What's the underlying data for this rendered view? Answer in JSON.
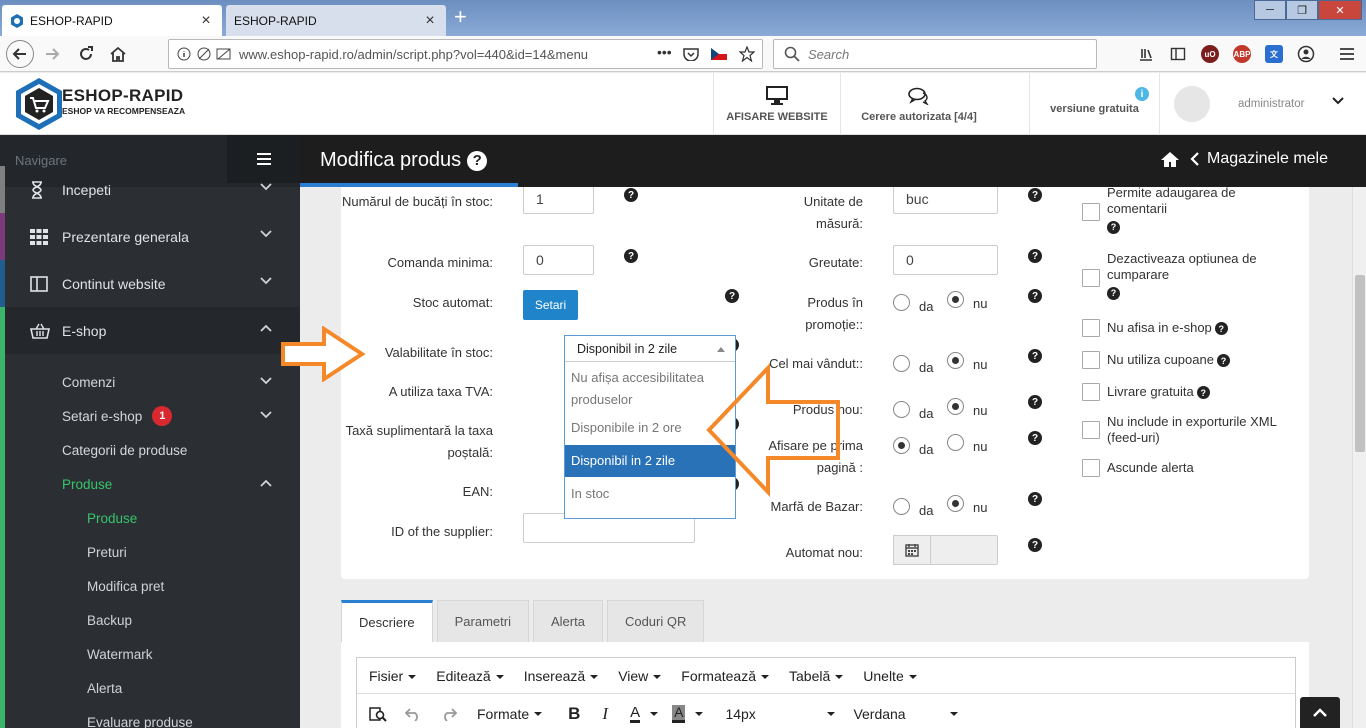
{
  "browser": {
    "tabs": [
      {
        "title": "ESHOP-RAPID"
      },
      {
        "title": "ESHOP-RAPID"
      }
    ],
    "url": "www.eshop-rapid.ro/admin/script.php?vol=440&id=14&menu",
    "search_placeholder": "Search"
  },
  "header": {
    "logo_name": "ESHOP-RAPID",
    "logo_tagline": "ESHOP VA RECOMPENSEAZA",
    "website_button": "AFISARE WEBSITE",
    "request_button": "Cerere autorizata [4/4]",
    "version_label": "versiune gratuita",
    "user_name": "administrator"
  },
  "sidebar": {
    "nav_label": "Navigare",
    "items": [
      {
        "label": "Incepeti",
        "icon": "hourglass-icon"
      },
      {
        "label": "Prezentare generala",
        "icon": "grid-icon"
      },
      {
        "label": "Continut website",
        "icon": "columns-icon"
      },
      {
        "label": "E-shop",
        "icon": "basket-icon"
      }
    ],
    "eshop_sub": [
      {
        "label": "Comenzi"
      },
      {
        "label": "Setari e-shop",
        "badge": "1"
      },
      {
        "label": "Categorii de produse"
      },
      {
        "label": "Produse"
      }
    ],
    "produse_sub": [
      {
        "label": "Produse"
      },
      {
        "label": "Preturi"
      },
      {
        "label": "Modifica pret"
      },
      {
        "label": "Backup"
      },
      {
        "label": "Watermark"
      },
      {
        "label": "Alerta"
      },
      {
        "label": "Evaluare produse"
      }
    ]
  },
  "titlebar": {
    "title": "Modifica produs",
    "stores_link": "Magazinele mele"
  },
  "form": {
    "left": {
      "pieces_label": "Numărul de bucăți în stoc:",
      "pieces_value": "1",
      "min_order_label": "Comanda minima:",
      "min_order_value": "0",
      "auto_stock_label": "Stoc automat:",
      "settings_button": "Setari",
      "availability_label": "Valabilitate în stoc:",
      "vat_label": "A utiliza taxa TVA:",
      "postal_label": "Taxă suplimentară la taxa poștală:",
      "ean_label": "EAN:",
      "supplier_label": "ID of the supplier:"
    },
    "dropdown": {
      "selected": "Disponibil in 2 zile",
      "options": [
        "Nu afișa accesibilitatea produselor",
        "Disponibile in 2 ore",
        "Disponibil in 2 zile",
        "In stoc"
      ]
    },
    "middle": {
      "unit_label": "Unitate de măsură:",
      "unit_value": "buc",
      "weight_label": "Greutate:",
      "weight_value": "0",
      "promo_label": "Produs în promoție::",
      "bestseller_label": "Cel mai vândut::",
      "new_label": "Produs nou:",
      "homepage_label": "Afisare pe prima pagină :",
      "bazaar_label": "Marfă de Bazar:",
      "auto_new_label": "Automat nou:",
      "yes": "da",
      "no": "nu"
    },
    "right": {
      "allow_comments": "Permite adaugarea de comentarii",
      "disable_buy": "Dezactiveaza optiunea de cumparare",
      "hide_eshop": "Nu afisa in e-shop",
      "no_coupons": "Nu utiliza cupoane",
      "free_shipping": "Livrare gratuita",
      "no_xml": "Nu include in exporturile XML (feed-uri)",
      "hide_alert": "Ascunde alerta"
    }
  },
  "content_tabs": [
    "Descriere",
    "Parametri",
    "Alerta",
    "Coduri QR"
  ],
  "editor": {
    "menus": [
      "Fisier",
      "Editează",
      "Inserează",
      "View",
      "Formatează",
      "Tabelă",
      "Unelte"
    ],
    "format_label": "Formate",
    "font_size": "14px",
    "font_family": "Verdana"
  },
  "colors": {
    "accent_blue": "#2b7fd0",
    "sidebar_bg": "#2b2f33",
    "active_green": "#36c46d",
    "arrow_orange": "#f5892a",
    "selected_option": "#2a72b8"
  }
}
